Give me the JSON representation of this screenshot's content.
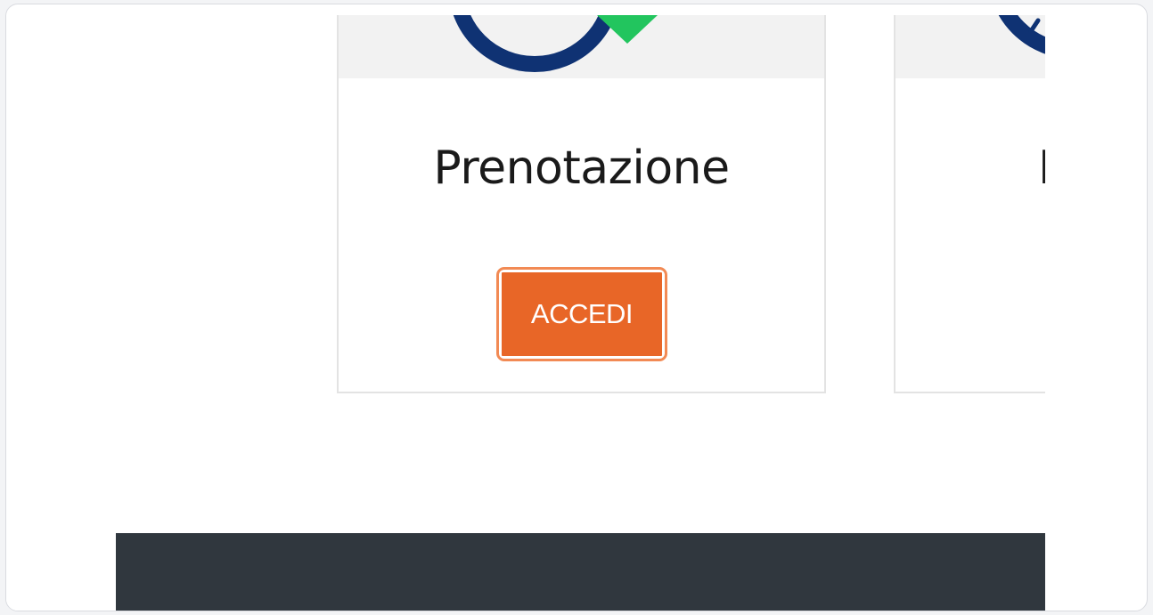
{
  "cards": [
    {
      "title": "Prenotazione",
      "button_label": "ACCEDI",
      "icon": "clock-checkmark-icon"
    },
    {
      "title": "I",
      "icon": "clock-icon"
    }
  ],
  "colors": {
    "button_bg": "#e86627",
    "button_focus_ring": "#f28a54",
    "icon_ring": "#0f3273",
    "icon_check": "#22c55e",
    "footer_bg": "#30373e",
    "card_image_bg": "#f2f2f2"
  }
}
